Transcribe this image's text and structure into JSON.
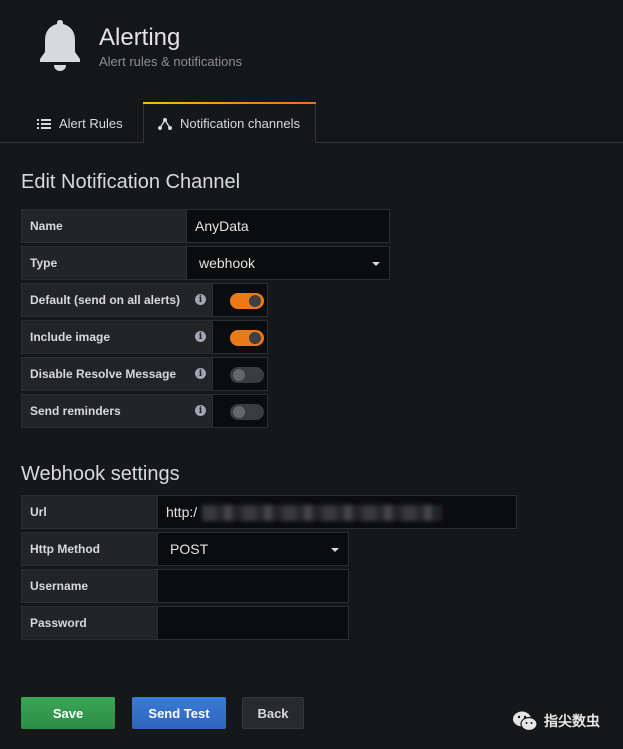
{
  "header": {
    "title": "Alerting",
    "subtitle": "Alert rules & notifications",
    "icon": "bell-icon"
  },
  "tabs": [
    {
      "label": "Alert Rules",
      "icon": "list-icon",
      "active": false
    },
    {
      "label": "Notification channels",
      "icon": "channel-icon",
      "active": true
    }
  ],
  "edit_section": {
    "title": "Edit Notification Channel",
    "name_label": "Name",
    "name_value": "AnyData",
    "type_label": "Type",
    "type_value": "webhook",
    "default_label": "Default (send on all alerts)",
    "default_on": true,
    "include_image_label": "Include image",
    "include_image_on": true,
    "disable_resolve_label": "Disable Resolve Message",
    "disable_resolve_on": false,
    "send_reminders_label": "Send reminders",
    "send_reminders_on": false
  },
  "webhook_section": {
    "title": "Webhook settings",
    "url_label": "Url",
    "url_value": "http:/",
    "method_label": "Http Method",
    "method_value": "POST",
    "username_label": "Username",
    "username_value": "",
    "password_label": "Password",
    "password_value": ""
  },
  "buttons": {
    "save": "Save",
    "send_test": "Send Test",
    "back": "Back"
  },
  "watermark": {
    "text": "指尖数虫"
  },
  "colors": {
    "toggle_on": "#eb7b18",
    "save": "#2f9a4c",
    "send_test": "#3272cc"
  }
}
